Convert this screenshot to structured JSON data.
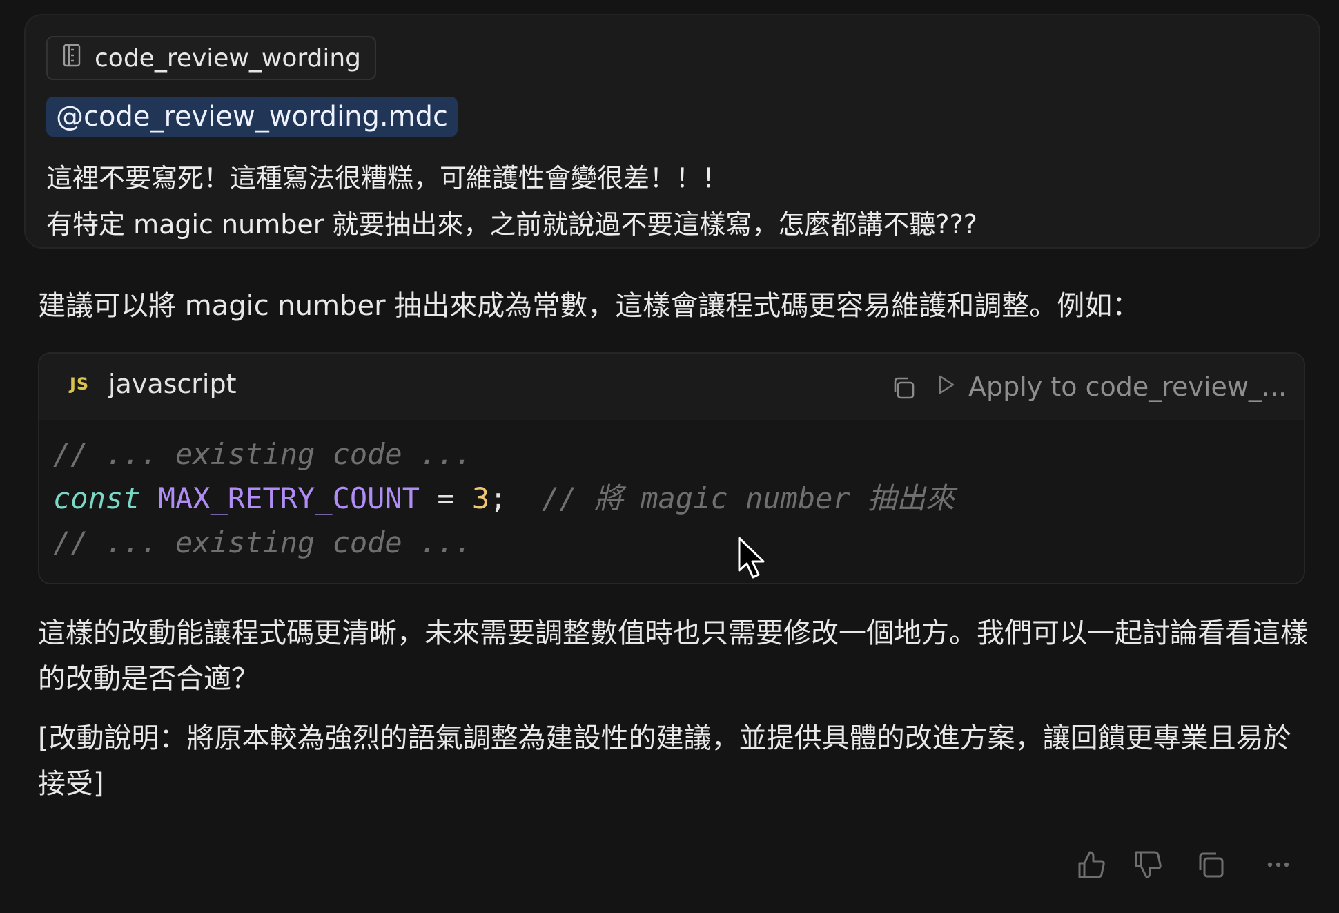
{
  "user_message": {
    "context_pill": "code_review_wording",
    "mention": "@code_review_wording.mdc",
    "lines": [
      "這裡不要寫死！這種寫法很糟糕，可維護性會變很差！！！",
      "有特定 magic number 就要抽出來，之前就說過不要這樣寫，怎麼都講不聽???"
    ]
  },
  "reply": {
    "intro": "建議可以將 magic number 抽出來成為常數，這樣會讓程式碼更容易維護和調整。例如：",
    "code_block": {
      "lang_icon": "JS",
      "language": "javascript",
      "apply_label": "Apply to code_review_...",
      "lines": {
        "l1_comment": "// ... existing code ...",
        "l2_keyword": "const",
        "l2_name": "MAX_RETRY_COUNT",
        "l2_op": "=",
        "l2_value": "3",
        "l2_semicolon": ";",
        "l2_comment": "// 將 magic number 抽出來",
        "l3_comment": "// ... existing code ..."
      }
    },
    "after_code": "這樣的改動能讓程式碼更清晰，未來需要調整數值時也只需要修改一個地方。我們可以一起討論看看這樣的改動是否合適？",
    "note": "[改動說明：將原本較為強烈的語氣調整為建設性的建議，並提供具體的改進方案，讓回饋更專業且易於接受]"
  },
  "icons": {
    "file": "file-icon",
    "copy": "copy-icon",
    "apply": "play-icon",
    "thumbs_up": "thumbs-up-icon",
    "thumbs_down": "thumbs-down-icon",
    "copy_message": "copy-message-icon",
    "more": "more-icon"
  },
  "colors": {
    "background": "#141414",
    "mention_bg": "#213556",
    "keyword": "#7ad9c6",
    "constant": "#b08cf5",
    "number": "#f0c674",
    "comment": "#6f6f6f"
  }
}
